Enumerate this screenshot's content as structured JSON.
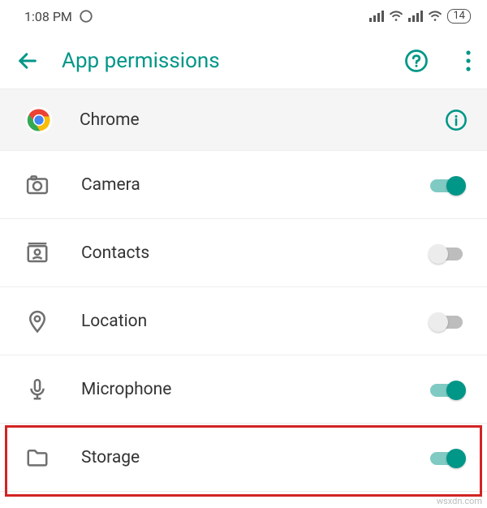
{
  "status_bar": {
    "time": "1:08 PM",
    "battery": "14"
  },
  "header": {
    "title": "App permissions"
  },
  "app": {
    "name": "Chrome"
  },
  "permissions": [
    {
      "label": "Camera",
      "enabled": true,
      "icon": "camera-icon"
    },
    {
      "label": "Contacts",
      "enabled": false,
      "icon": "contacts-icon"
    },
    {
      "label": "Location",
      "enabled": false,
      "icon": "location-icon"
    },
    {
      "label": "Microphone",
      "enabled": true,
      "icon": "microphone-icon"
    },
    {
      "label": "Storage",
      "enabled": true,
      "icon": "storage-icon"
    }
  ],
  "highlighted_permission": "Storage",
  "colors": {
    "accent": "#009688",
    "highlight": "#d22424"
  },
  "watermark": "wsxdn.com"
}
